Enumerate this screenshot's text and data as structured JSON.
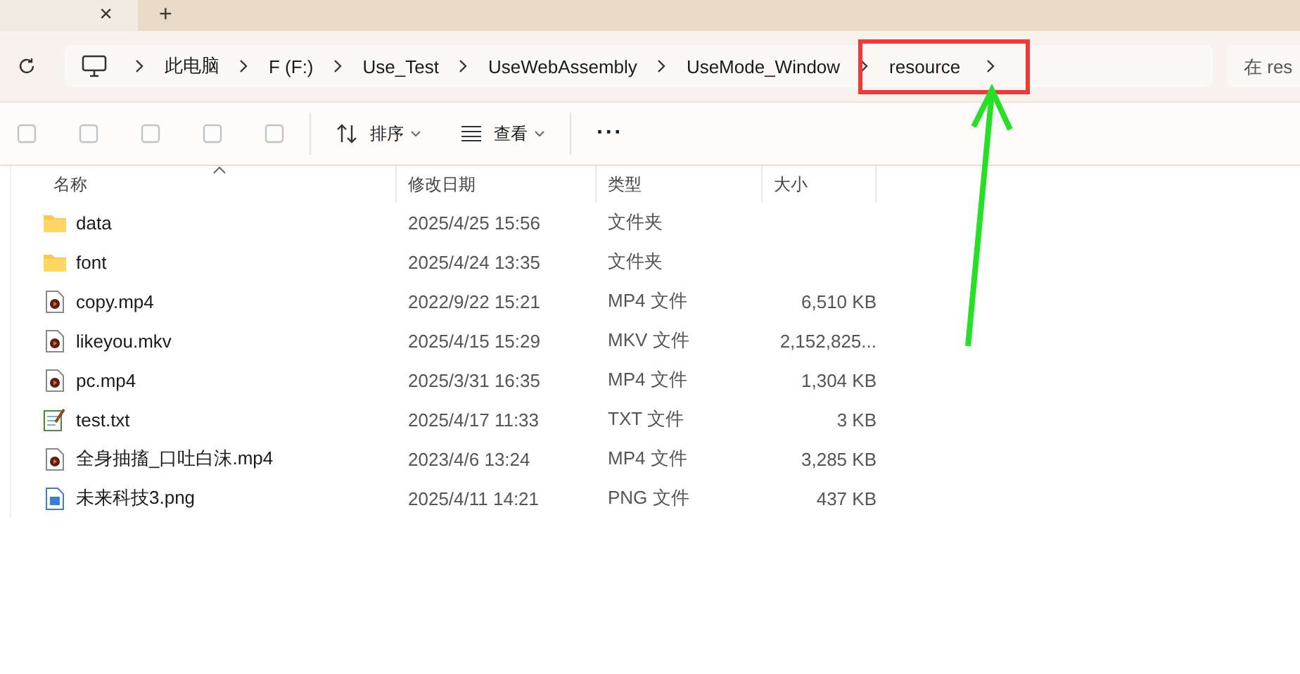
{
  "tabs": [
    {
      "close": "×",
      "selected": true
    }
  ],
  "new_tab": "+",
  "breadcrumbs": [
    "此电脑",
    "F (F:)",
    "Use_Test",
    "UseWebAssembly",
    "UseMode_Window",
    "resource"
  ],
  "search": {
    "placeholder": "在 res"
  },
  "toolbar": {
    "sort": "排序",
    "view": "查看",
    "more": "···"
  },
  "table": {
    "columns": [
      "名称",
      "修改日期",
      "类型",
      "大小"
    ],
    "rows": [
      {
        "kind": "folder",
        "name": "data",
        "date": "2025/4/25 15:56",
        "type": "文件夹",
        "size": ""
      },
      {
        "kind": "folder",
        "name": "font",
        "date": "2025/4/24 13:35",
        "type": "文件夹",
        "size": ""
      },
      {
        "kind": "video",
        "name": "copy.mp4",
        "date": "2022/9/22 15:21",
        "type": "MP4 文件",
        "size": "6,510 KB"
      },
      {
        "kind": "video",
        "name": "likeyou.mkv",
        "date": "2025/4/15 15:29",
        "type": "MKV 文件",
        "size": "2,152,825..."
      },
      {
        "kind": "video",
        "name": "pc.mp4",
        "date": "2025/3/31 16:35",
        "type": "MP4 文件",
        "size": "1,304 KB"
      },
      {
        "kind": "text",
        "name": "test.txt",
        "date": "2025/4/17 11:33",
        "type": "TXT 文件",
        "size": "3 KB"
      },
      {
        "kind": "video",
        "name": "全身抽搐_口吐白沫.mp4",
        "date": "2023/4/6 13:24",
        "type": "MP4 文件",
        "size": "3,285 KB"
      },
      {
        "kind": "image",
        "name": "未来科技3.png",
        "date": "2025/4/11 14:21",
        "type": "PNG 文件",
        "size": "437 KB"
      }
    ]
  }
}
